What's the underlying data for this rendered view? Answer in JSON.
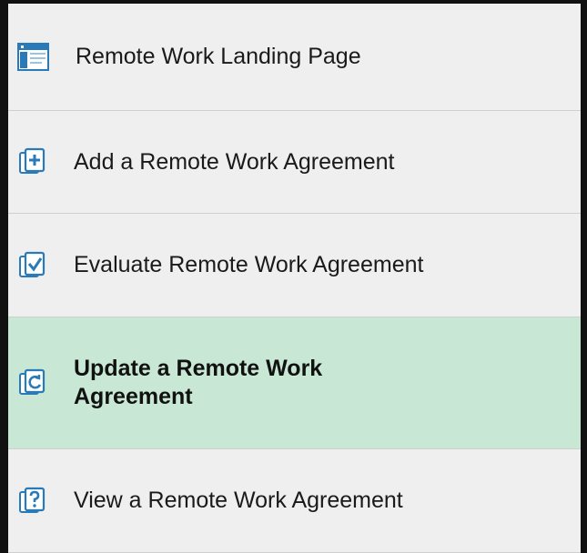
{
  "menu": {
    "items": [
      {
        "label": "Remote Work Landing Page",
        "icon": "landing-page-icon",
        "active": false
      },
      {
        "label": "Add a Remote Work Agreement",
        "icon": "add-document-icon",
        "active": false
      },
      {
        "label": "Evaluate Remote Work Agreement",
        "icon": "evaluate-document-icon",
        "active": false
      },
      {
        "label": "Update a Remote Work Agreement",
        "icon": "update-document-icon",
        "active": true
      },
      {
        "label": "View a Remote Work Agreement",
        "icon": "view-document-icon",
        "active": false
      }
    ]
  },
  "colors": {
    "active_background": "#c8e8d5",
    "item_background": "#efefef",
    "icon_blue": "#2a7ab8",
    "divider": "#cfcfcf"
  }
}
